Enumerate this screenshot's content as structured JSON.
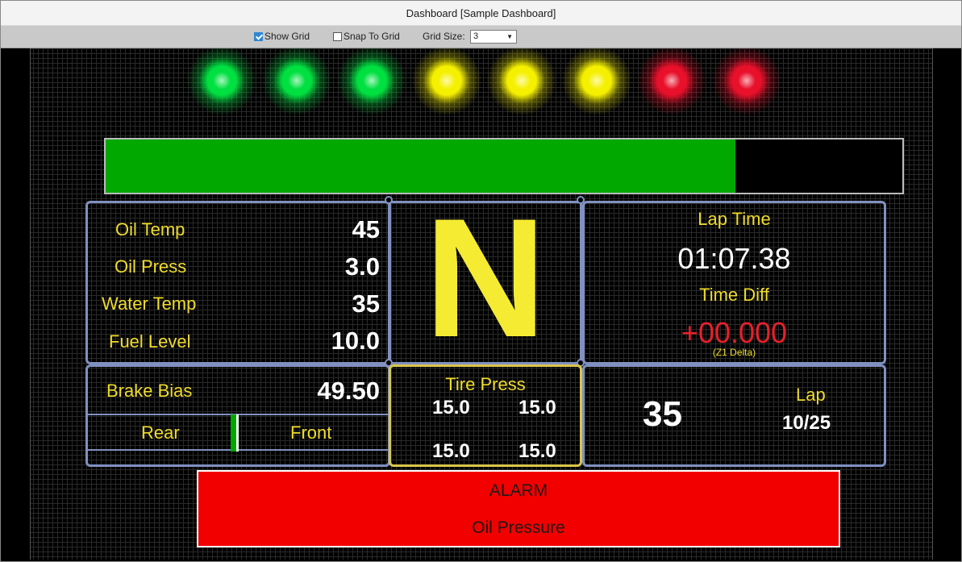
{
  "window": {
    "title": "Dashboard [Sample Dashboard]"
  },
  "toolbar": {
    "show_grid_label": "Show Grid",
    "show_grid_checked": true,
    "snap_label": "Snap To Grid",
    "snap_checked": false,
    "grid_size_label": "Grid Size:",
    "grid_size_value": "3"
  },
  "leds": [
    {
      "color": "#00e040"
    },
    {
      "color": "#00e040"
    },
    {
      "color": "#00e040"
    },
    {
      "color": "#f5f000"
    },
    {
      "color": "#f5f000"
    },
    {
      "color": "#f5f000"
    },
    {
      "color": "#e8102a"
    },
    {
      "color": "#e8102a"
    }
  ],
  "rpm_bar": {
    "fill_fraction": 0.79,
    "color": "#00a800"
  },
  "sensors": [
    {
      "label": "Oil Temp",
      "value": "45"
    },
    {
      "label": "Oil Press",
      "value": "3.0"
    },
    {
      "label": "Water Temp",
      "value": "35"
    },
    {
      "label": "Fuel Level",
      "value": "10.0"
    }
  ],
  "gear": {
    "value": "N",
    "color": "#f5eb32"
  },
  "lap_time": {
    "label": "Lap Time",
    "value": "01:07.38",
    "diff_label": "Time Diff",
    "diff_value": "+00.000",
    "diff_note": "(Z1 Delta)"
  },
  "brake_bias": {
    "label": "Brake Bias",
    "value": "49.50",
    "rear_label": "Rear",
    "front_label": "Front"
  },
  "tire_press": {
    "label": "Tire Press",
    "fl": "15.0",
    "fr": "15.0",
    "rl": "15.0",
    "rr": "15.0"
  },
  "lap": {
    "big_value": "35",
    "label": "Lap",
    "count": "10/25"
  },
  "alarm": {
    "title": "ALARM",
    "message": "Oil Pressure",
    "color": "#f20000"
  }
}
